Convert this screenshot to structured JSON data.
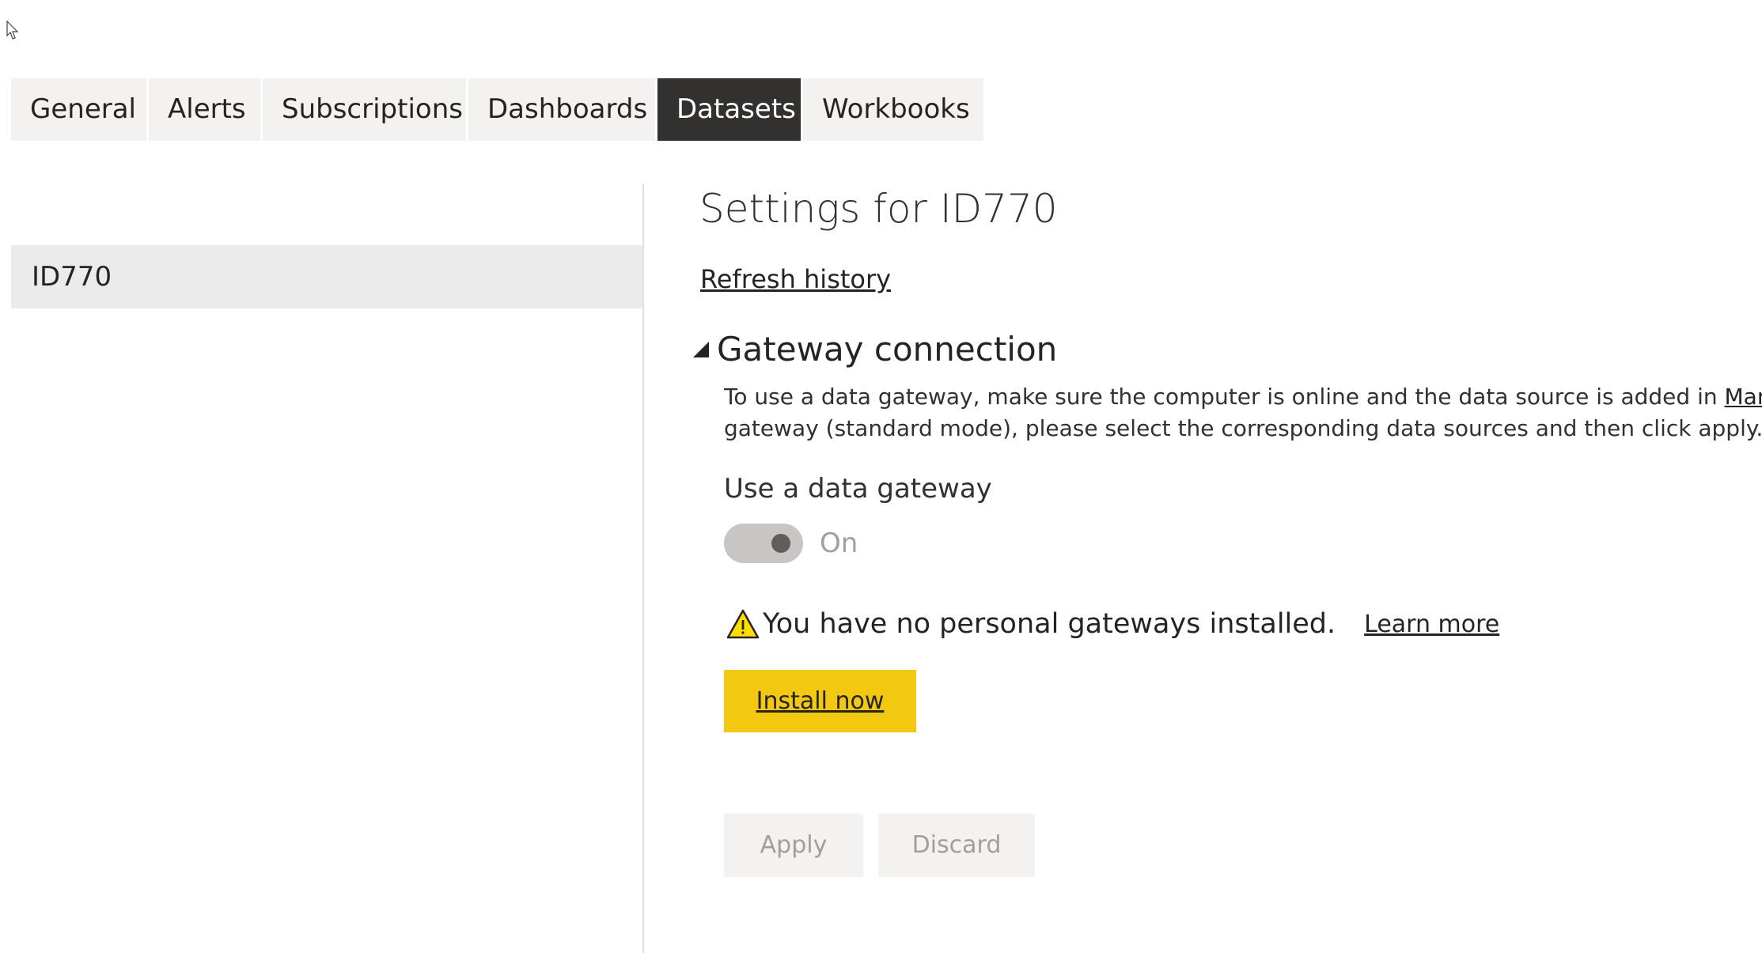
{
  "tabs": [
    {
      "label": "General",
      "active": false
    },
    {
      "label": "Alerts",
      "active": false
    },
    {
      "label": "Subscriptions",
      "active": false
    },
    {
      "label": "Dashboards",
      "active": false
    },
    {
      "label": "Datasets",
      "active": true
    },
    {
      "label": "Workbooks",
      "active": false
    }
  ],
  "sidebar": {
    "items": [
      {
        "label": "ID770",
        "selected": true
      }
    ]
  },
  "main": {
    "title": "Settings for ID770",
    "refresh_history_link": "Refresh history",
    "gateway_section": {
      "title": "Gateway connection",
      "expanded": true,
      "description_line1_prefix": "To use a data gateway, make sure the computer is online and the data source is added in ",
      "description_line1_link": "Manage G",
      "description_line2": "gateway (standard mode), please select the corresponding data sources and then click apply.",
      "use_gateway_label": "Use a data gateway",
      "toggle_state_text": "On",
      "toggle_on": true,
      "toggle_disabled": true,
      "warning_text": "You have no personal gateways installed.",
      "learn_more_link": "Learn more",
      "install_button": "Install now"
    },
    "actions": {
      "apply_label": "Apply",
      "discard_label": "Discard",
      "disabled": true
    }
  },
  "colors": {
    "active_tab_bg": "#323130",
    "tab_bg": "#f3f2f1",
    "install_button_bg": "#f2c811",
    "warning_icon_fill": "#ffdd00",
    "selected_item_bg": "#ebebeb",
    "disabled_text": "#a19f9d"
  },
  "icons": {
    "cursor": "mouse-pointer-icon",
    "warning": "warning-triangle-icon",
    "collapse": "expanded-triangle-icon"
  }
}
